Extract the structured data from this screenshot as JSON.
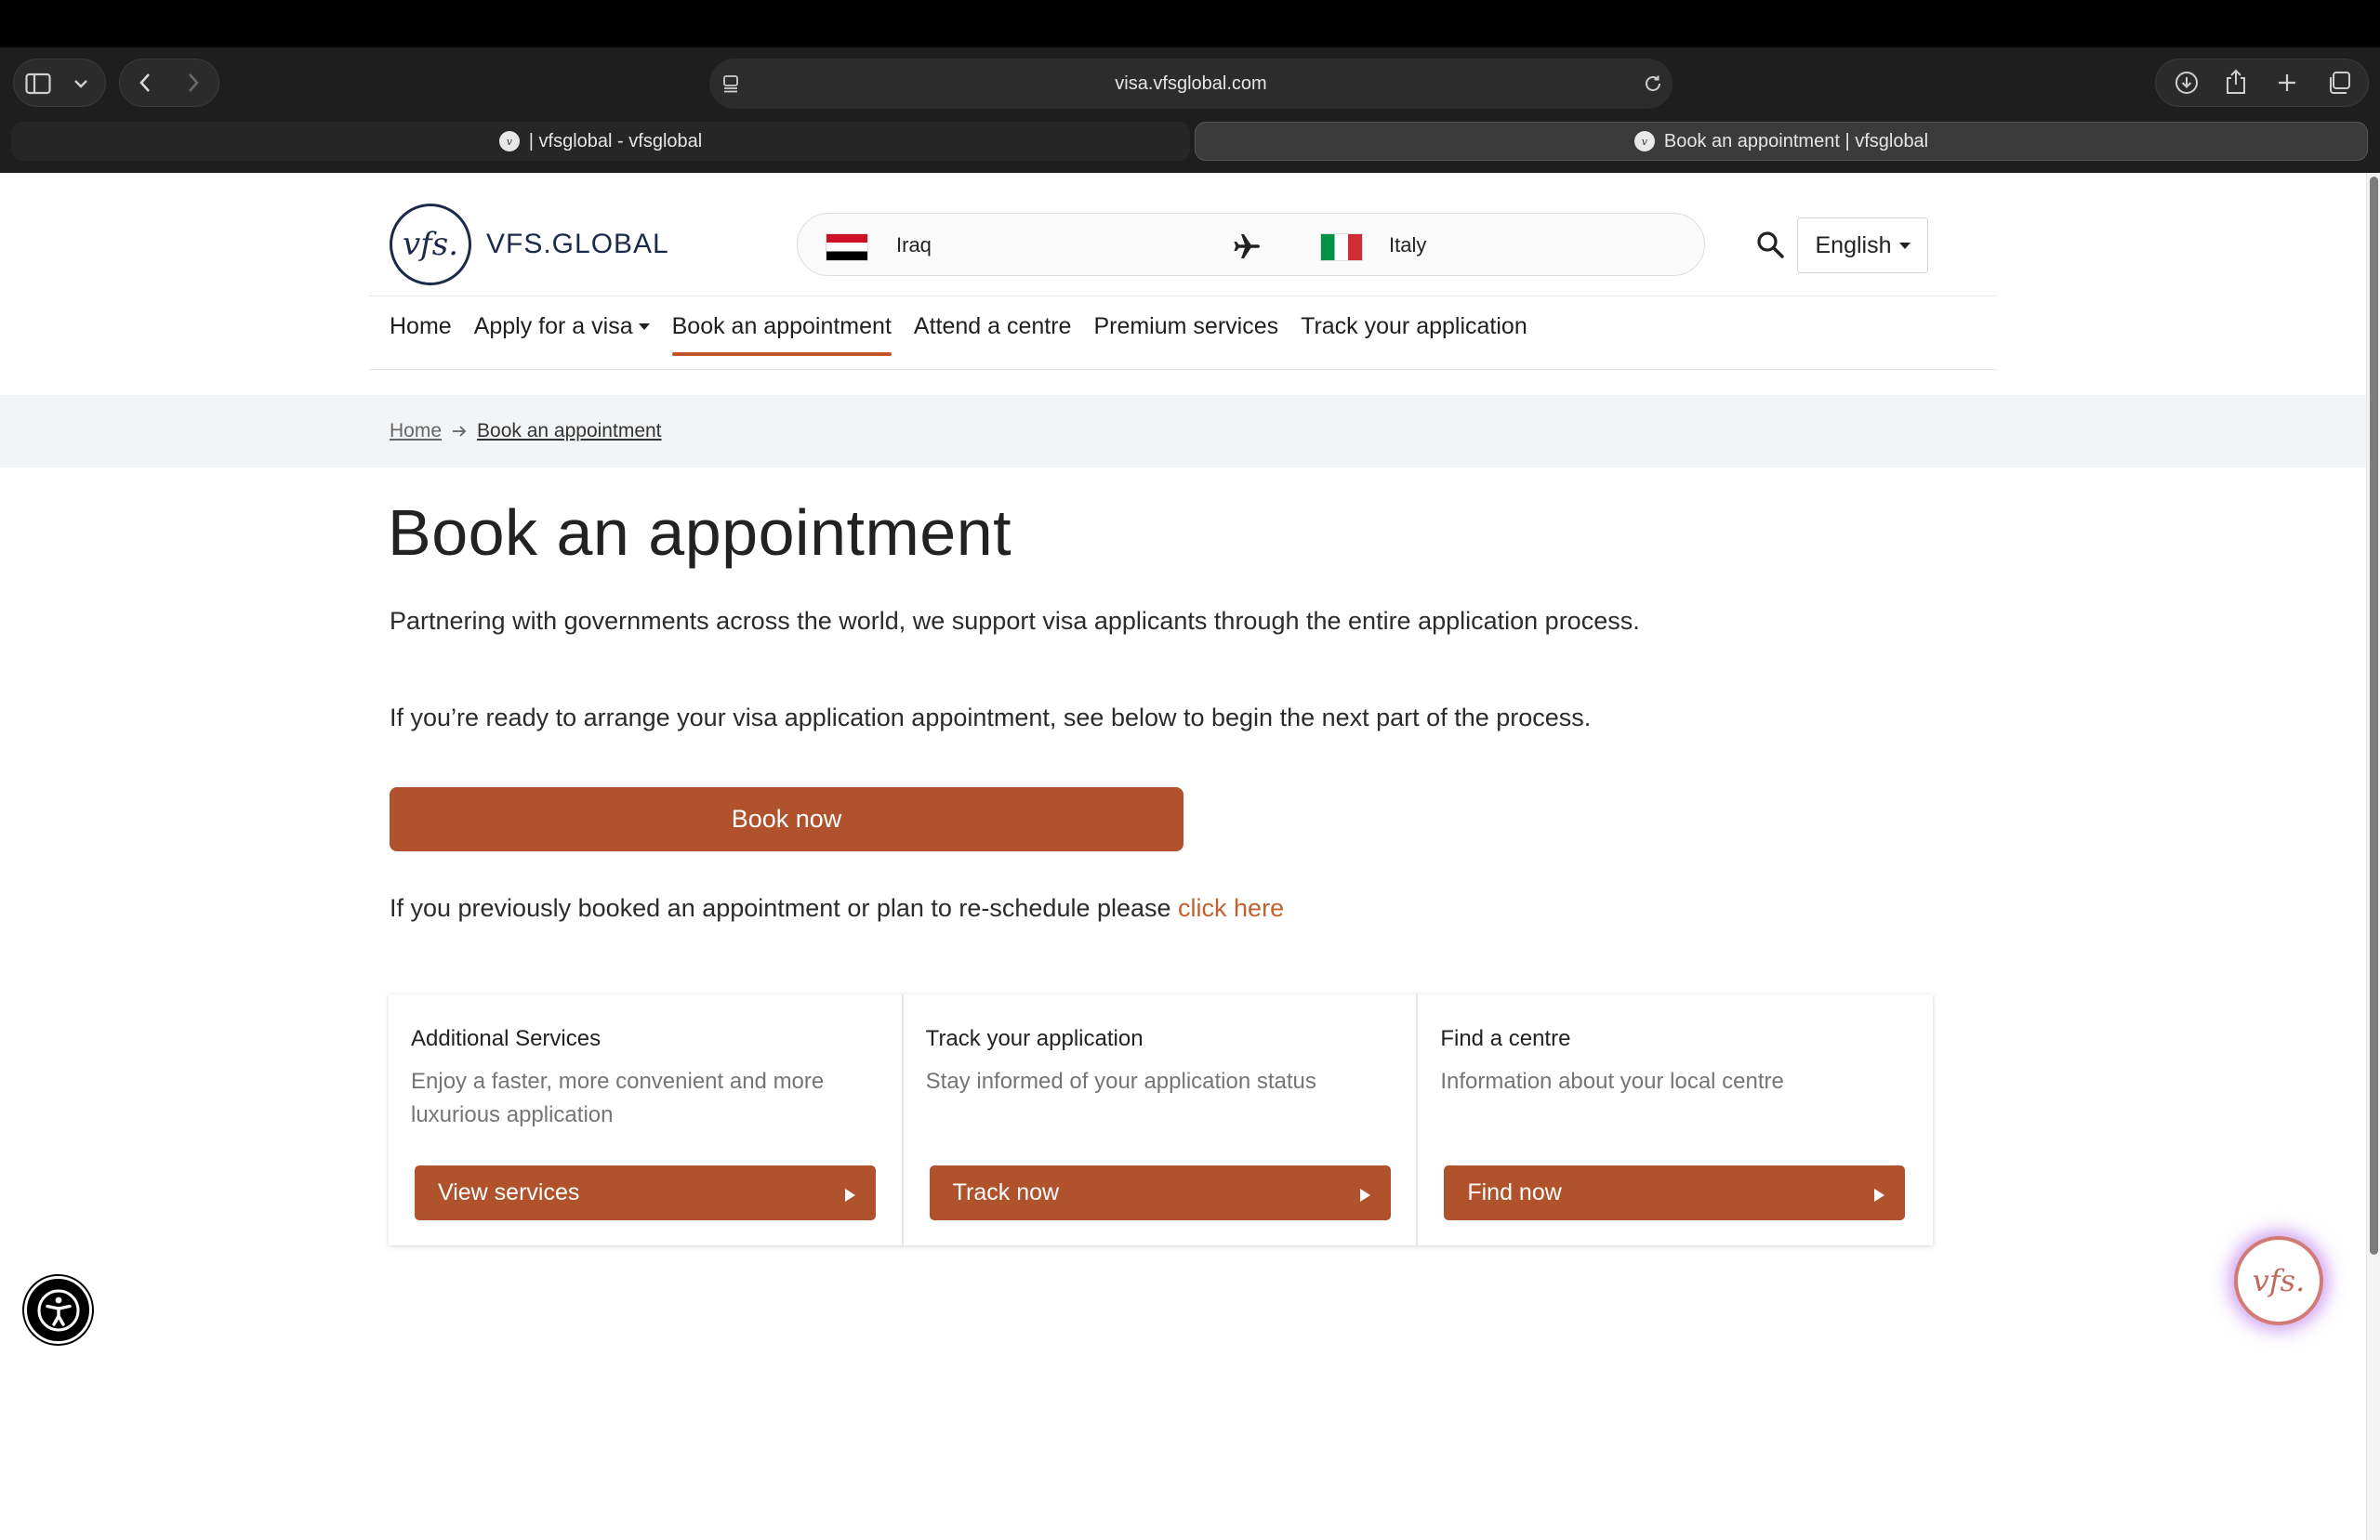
{
  "browser": {
    "url": "visa.vfsglobal.com",
    "tabs": [
      {
        "label": "| vfsglobal - vfsglobal",
        "active": false
      },
      {
        "label": "Book an appointment | vfsglobal",
        "active": true
      }
    ]
  },
  "header": {
    "logo_mark": "vfs.",
    "logo_text": "VFS.GLOBAL",
    "route": {
      "from": "Iraq",
      "to": "Italy"
    },
    "language": "English"
  },
  "nav": {
    "items": [
      {
        "label": "Home",
        "dropdown": false,
        "active": false
      },
      {
        "label": "Apply for a visa",
        "dropdown": true,
        "active": false
      },
      {
        "label": "Book an appointment",
        "dropdown": false,
        "active": true
      },
      {
        "label": "Attend a centre",
        "dropdown": false,
        "active": false
      },
      {
        "label": "Premium services",
        "dropdown": false,
        "active": false
      },
      {
        "label": "Track your application",
        "dropdown": false,
        "active": false
      }
    ]
  },
  "breadcrumb": {
    "home": "Home",
    "current": "Book an appointment"
  },
  "main": {
    "title": "Book an appointment",
    "intro": "Partnering with governments across the world, we support visa applicants through the entire application process.",
    "ready_text": "If you’re ready to arrange your visa application appointment, see below to begin the next part of the process.",
    "book_button": "Book now",
    "reschedule_text": "If you previously booked an appointment or plan to re-schedule please ",
    "reschedule_link": "click here"
  },
  "cards": [
    {
      "title": "Additional Services",
      "desc": "Enjoy a faster, more convenient and more luxurious application",
      "button": "View services"
    },
    {
      "title": "Track your application",
      "desc": "Stay informed of your application status",
      "button": "Track now"
    },
    {
      "title": "Find a centre",
      "desc": "Information about your local centre",
      "button": "Find now"
    }
  ],
  "chat_widget": {
    "label": "vfs."
  },
  "colors": {
    "accent": "#b0522b",
    "link": "#c2612e",
    "brand_navy": "#1c2a4a"
  }
}
